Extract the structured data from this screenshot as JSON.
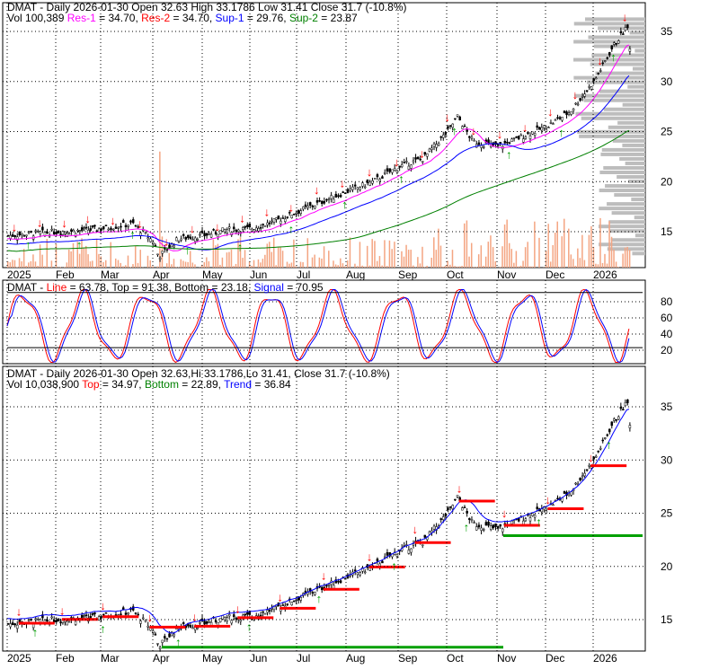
{
  "panel1": {
    "title": "DMAT - Daily 2026-01-30 Open 32.63  High 33.1786  Low 31.41  Close 31.7 (-10.8%)",
    "vol": "Vol 100,389",
    "res1_label": "Res-1",
    "res1_val": " = 34.70, ",
    "res2_label": "Res-2",
    "res2_val": " = 34.70, ",
    "sup1_label": "Sup-1",
    "sup1_val": " = 29.76, ",
    "sup2_label": "Sup-2",
    "sup2_val": " = 23.87"
  },
  "panel2": {
    "prefix": "DMAT - ",
    "line_label": "Line",
    "line_val": " = 63.78, Top = 91.38, Bottom = 23.18, ",
    "signal_label": "Signal",
    "signal_val": " = 70.95"
  },
  "panel3": {
    "title": "DMAT - Daily 2026-01-30 Open 32.63,Hi 33.1786,Lo 31.41, Close 31.7 (-10.8%)",
    "vol": "Vol 10,038,900",
    "top_label": "Top",
    "top_val": " = 34.97, ",
    "bottom_label": "Bottom",
    "bottom_val": " = 22.89, ",
    "trend_label": "Trend",
    "trend_val": " = 36.84"
  },
  "colors": {
    "res1": "#ff00ff",
    "res2": "#ff0000",
    "sup1": "#0000ff",
    "sup2": "#008000",
    "up": "#00a000",
    "down": "#ff0000",
    "profile": "#bdbdbd",
    "volume": "#f4a582"
  },
  "chart_data": {
    "type": "candlestick",
    "x_ticks": [
      "2025",
      "Feb",
      "Mar",
      "Apr",
      "May",
      "Jun",
      "Jul",
      "Aug",
      "Sep",
      "Oct",
      "Nov",
      "Dec",
      "2026"
    ],
    "price_ticks": [
      15,
      20,
      25,
      30,
      35
    ],
    "stoch_ticks": [
      20,
      40,
      60,
      80
    ],
    "price_anchors": {
      "months": [
        0,
        0.5,
        1,
        1.5,
        2,
        2.6,
        3.0,
        3.1,
        3.5,
        4,
        4.5,
        5,
        5.5,
        6,
        6.5,
        7,
        7.5,
        8,
        8.5,
        9,
        9.2,
        9.5,
        10,
        10.5,
        11,
        11.5,
        12,
        12.4,
        12.7,
        12.8
      ],
      "close": [
        14.6,
        14.8,
        15.0,
        15.1,
        15.3,
        15.8,
        14.0,
        12.5,
        14.3,
        14.6,
        15.2,
        15.3,
        16.0,
        17.0,
        18.0,
        19.0,
        20.0,
        21.5,
        22.3,
        25.0,
        26.5,
        24.0,
        23.5,
        24.5,
        25.5,
        27.0,
        30.0,
        33.5,
        35.5,
        31.7
      ]
    },
    "stochastic": {
      "line": 63.78,
      "top": 91.38,
      "bottom": 23.18,
      "signal": 70.95
    },
    "levels": {
      "res1": 34.7,
      "res2": 34.7,
      "sup1": 29.76,
      "sup2": 23.87,
      "top": 34.97,
      "bottom": 22.89,
      "trend": 36.84
    }
  }
}
